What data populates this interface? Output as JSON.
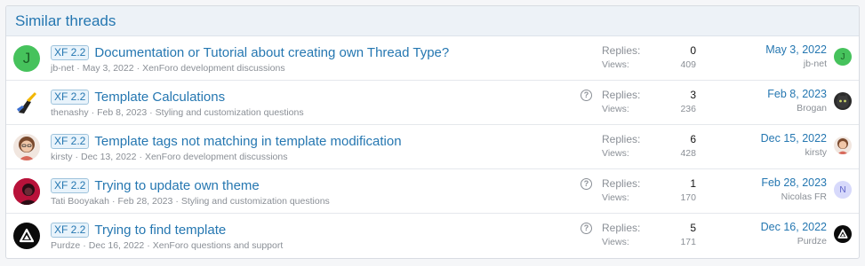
{
  "header": {
    "title": "Similar threads"
  },
  "stat_labels": {
    "replies": "Replies:",
    "views": "Views:"
  },
  "threads": [
    {
      "avatar_letter": "J",
      "prefix": "XF 2.2",
      "title": "Documentation or Tutorial about creating own Thread Type?",
      "author": "jb-net",
      "date": "May 3, 2022",
      "forum": "XenForo development discussions",
      "replies": "0",
      "views": "409",
      "last_date": "May 3, 2022",
      "last_user": "jb-net",
      "last_avatar_letter": "J"
    },
    {
      "prefix": "XF 2.2",
      "title": "Template Calculations",
      "author": "thenashy",
      "date": "Feb 8, 2023",
      "forum": "Styling and customization questions",
      "replies": "3",
      "views": "236",
      "last_date": "Feb 8, 2023",
      "last_user": "Brogan"
    },
    {
      "prefix": "XF 2.2",
      "title": "Template tags not matching in template modification",
      "author": "kirsty",
      "date": "Dec 13, 2022",
      "forum": "XenForo development discussions",
      "replies": "6",
      "views": "428",
      "last_date": "Dec 15, 2022",
      "last_user": "kirsty"
    },
    {
      "prefix": "XF 2.2",
      "title": "Trying to update own theme",
      "author": "Tati Booyakah",
      "date": "Feb 28, 2023",
      "forum": "Styling and customization questions",
      "replies": "1",
      "views": "170",
      "last_date": "Feb 28, 2023",
      "last_user": "Nicolas FR",
      "last_avatar_letter": "N"
    },
    {
      "prefix": "XF 2.2",
      "title": "Trying to find template",
      "author": "Purdze",
      "date": "Dec 16, 2022",
      "forum": "XenForo questions and support",
      "replies": "5",
      "views": "171",
      "last_date": "Dec 16, 2022",
      "last_user": "Purdze"
    }
  ],
  "colors": {
    "link": "#2577b1",
    "muted": "#8a8f96",
    "green_avatar": "#46c25c",
    "lavender_avatar": "#d7d9fb"
  },
  "icons": {
    "question": "question-circle-icon"
  }
}
